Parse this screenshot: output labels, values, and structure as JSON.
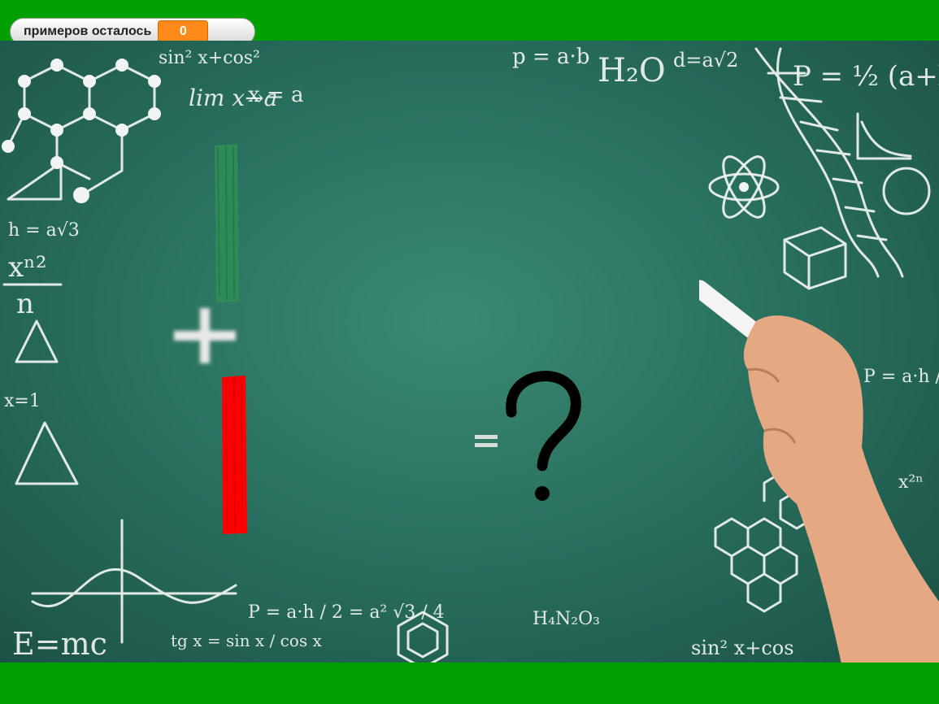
{
  "counter": {
    "label": "примеров осталось",
    "value": "0"
  },
  "task": {
    "answer_symbol": "?"
  },
  "board_formulas": [
    "sin² x+cos²",
    "p = a·b",
    "H₂O",
    "d=a√2",
    "P = ½ (a+b)",
    "lim x→a",
    "x = a",
    "h = a√3",
    "xⁿ²",
    "n",
    "x=1",
    "P = a·h / 2",
    "x²ⁿ",
    "E=mc",
    "tg x = sin x / cos x",
    "P = a·h / 2 = a² √3 / 4",
    "H₄N₂O₃",
    "sin² x+cos"
  ],
  "colors": {
    "frame": "#00a000",
    "board": "#2a7160",
    "stick_green": "#2e8b57",
    "stick_red": "#ff0000",
    "counter_value_bg": "#ff8a1a"
  }
}
